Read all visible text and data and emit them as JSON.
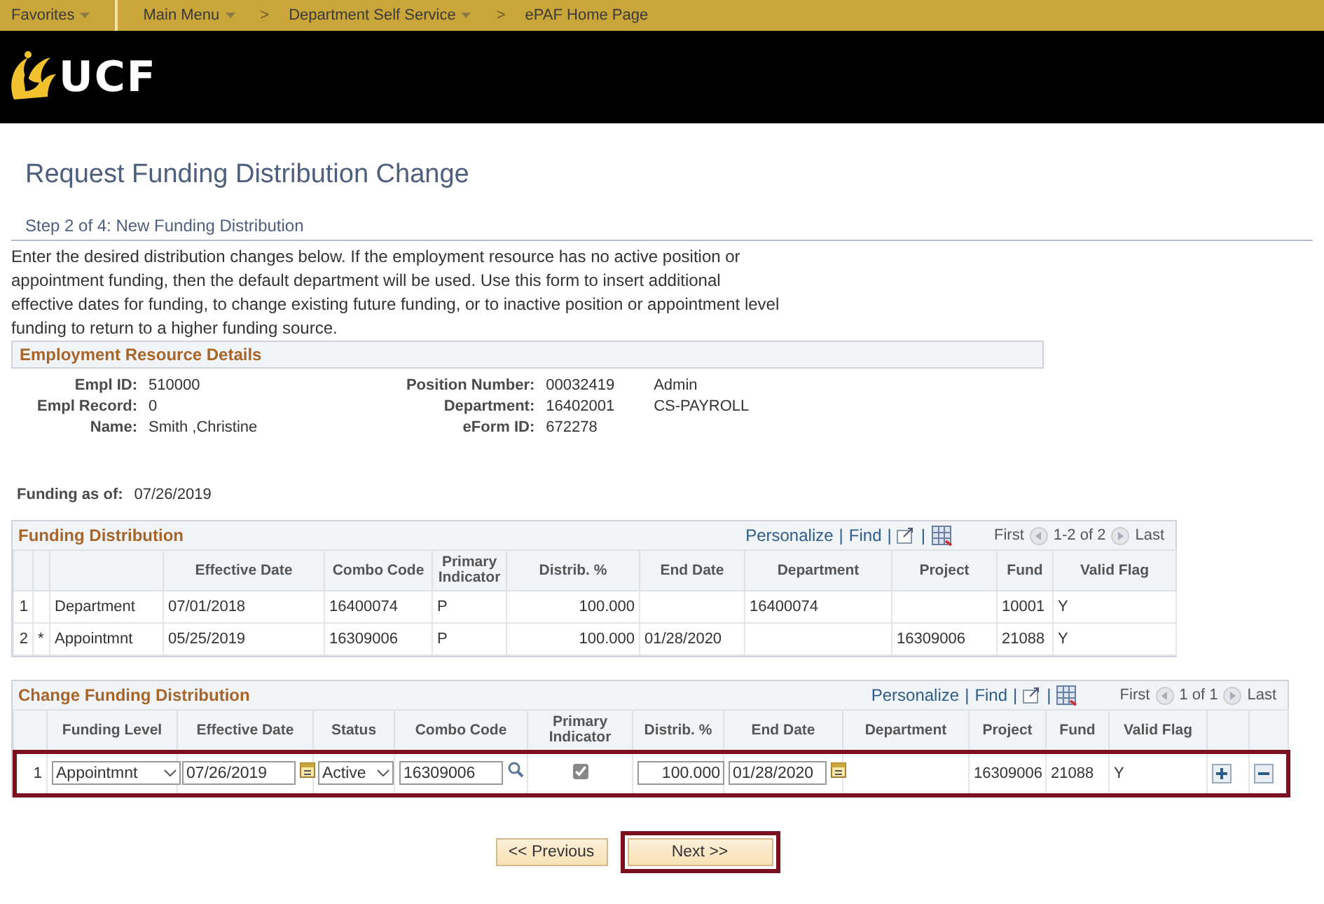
{
  "nav": {
    "items": [
      {
        "label": "Favorites",
        "menu": true
      },
      {
        "label": "Main Menu",
        "menu": true
      },
      {
        "label": "Department Self Service",
        "menu": true,
        "prefix": ">"
      },
      {
        "label": "ePAF Home Page",
        "menu": false,
        "prefix": ">"
      }
    ]
  },
  "header": {
    "logo_text": "UCF"
  },
  "page_title": "Request Funding Distribution Change",
  "step_title": "Step 2 of 4: New Funding Distribution",
  "instructions": "Enter the desired distribution changes below. If the employment resource has no active position or appointment funding, then the default department will be used. Use this form to insert additional effective dates for funding, to change existing future funding, or to inactive position or appointment level funding to return to a higher funding source.",
  "employment_details": {
    "title": "Employment Resource Details",
    "left_fields": [
      {
        "label": "Empl ID:",
        "value": "510000"
      },
      {
        "label": "Empl Record:",
        "value": "0"
      },
      {
        "label": "Name:",
        "value": "Smith ,Christine"
      }
    ],
    "right_fields": [
      {
        "label": "Position Number:",
        "value": "00032419",
        "extra": "Admin"
      },
      {
        "label": "Department:",
        "value": "16402001",
        "extra": "CS-PAYROLL"
      },
      {
        "label": "eForm ID:",
        "value": "672278"
      }
    ]
  },
  "funding_as_of": {
    "label": "Funding as of:",
    "value": "07/26/2019"
  },
  "funding_distribution": {
    "title": "Funding Distribution",
    "toolbar": {
      "personalize": "Personalize",
      "separators": [
        "|",
        "|",
        "|"
      ],
      "find": "Find",
      "first": "First",
      "range": "1-2 of 2",
      "last": "Last"
    },
    "columns": [
      "Effective Date",
      "Combo Code",
      "Primary Indicator",
      "Distrib. %",
      "End Date",
      "Department",
      "Project",
      "Fund",
      "Valid Flag"
    ],
    "rows": [
      {
        "number": "1",
        "level": "Department",
        "effective_date": "07/01/2018",
        "combo_code": "16400074",
        "primary_indicator": "P",
        "distrib": "100.000",
        "department": "16400074",
        "fund": "10001",
        "valid_flag": "Y"
      },
      {
        "number": "2",
        "marker": "*",
        "level": "Appointmnt",
        "effective_date": "05/25/2019",
        "combo_code": "16309006",
        "primary_indicator": "P",
        "distrib": "100.000",
        "end_date": "01/28/2020",
        "project": "16309006",
        "fund": "21088",
        "valid_flag": "Y"
      }
    ]
  },
  "change_funding_distribution": {
    "title": "Change Funding Distribution",
    "toolbar": {
      "personalize": "Personalize",
      "separators": [
        "|",
        "|",
        "|"
      ],
      "find": "Find",
      "first": "First",
      "range": "1 of 1",
      "last": "Last"
    },
    "columns": [
      "Funding Level",
      "Effective Date",
      "Status",
      "Combo Code",
      "Primary Indicator",
      "Distrib. %",
      "End Date",
      "Department",
      "Project",
      "Fund",
      "Valid Flag"
    ],
    "rows": [
      {
        "number": "1",
        "funding_level": "Appointmnt",
        "effective_date": "07/26/2019",
        "status": "Active",
        "combo_code": "16309006",
        "primary_checked": true,
        "distrib": "100.000",
        "end_date": "01/28/2020",
        "project": "16309006",
        "fund": "21088",
        "valid_flag": "Y",
        "highlighted": true
      }
    ]
  },
  "buttons": [
    {
      "label": "<< Previous",
      "highlighted": false
    },
    {
      "label": "Next >>",
      "highlighted": true
    }
  ]
}
